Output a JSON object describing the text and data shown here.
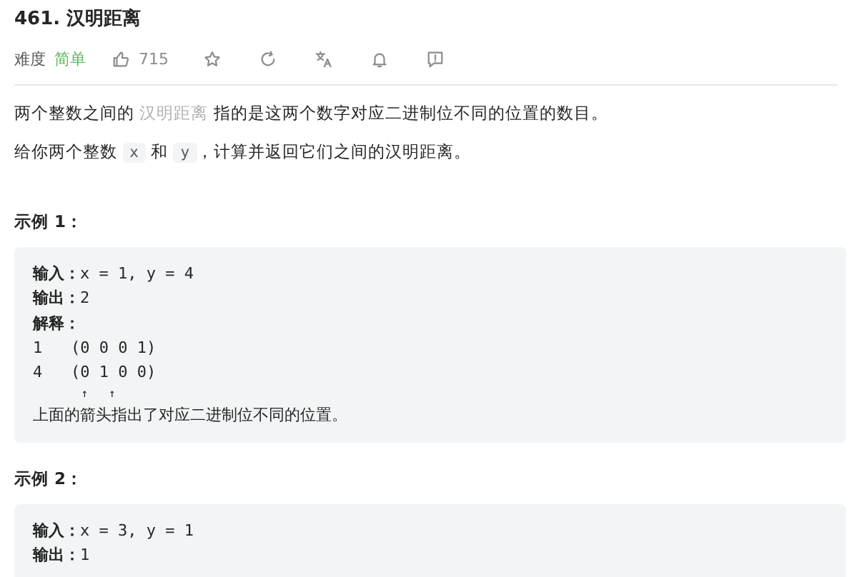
{
  "title": "461. 汉明距离",
  "meta": {
    "difficulty_label": "难度",
    "difficulty": "简单",
    "likes": "715"
  },
  "paragraphs": [
    [
      {
        "kind": "text",
        "text": "两个整数之间的 "
      },
      {
        "kind": "link",
        "text": "汉明距离"
      },
      {
        "kind": "text",
        "text": " 指的是这两个数字对应二进制位不同的位置的数目。"
      }
    ],
    [
      {
        "kind": "text",
        "text": "给你两个整数 "
      },
      {
        "kind": "code",
        "text": "x"
      },
      {
        "kind": "text",
        "text": " 和 "
      },
      {
        "kind": "code",
        "text": "y"
      },
      {
        "kind": "text",
        "text": "，计算并返回它们之间的汉明距离。"
      }
    ]
  ],
  "examples": [
    {
      "heading": "示例 1：",
      "lines": [
        {
          "label": "输入：",
          "value": "x = 1, y = 4"
        },
        {
          "label": "输出：",
          "value": "2"
        },
        {
          "label": "解释："
        },
        {
          "value": "1   (0 0 0 1)"
        },
        {
          "value": "4   (0 1 0 0)"
        },
        {
          "value": "       ↑   ↑",
          "kind": "arrows"
        },
        {
          "value": "上面的箭头指出了对应二进制位不同的位置。"
        }
      ]
    },
    {
      "heading": "示例 2：",
      "lines": [
        {
          "label": "输入：",
          "value": "x = 3, y = 1"
        },
        {
          "label": "输出：",
          "value": "1"
        }
      ]
    }
  ]
}
